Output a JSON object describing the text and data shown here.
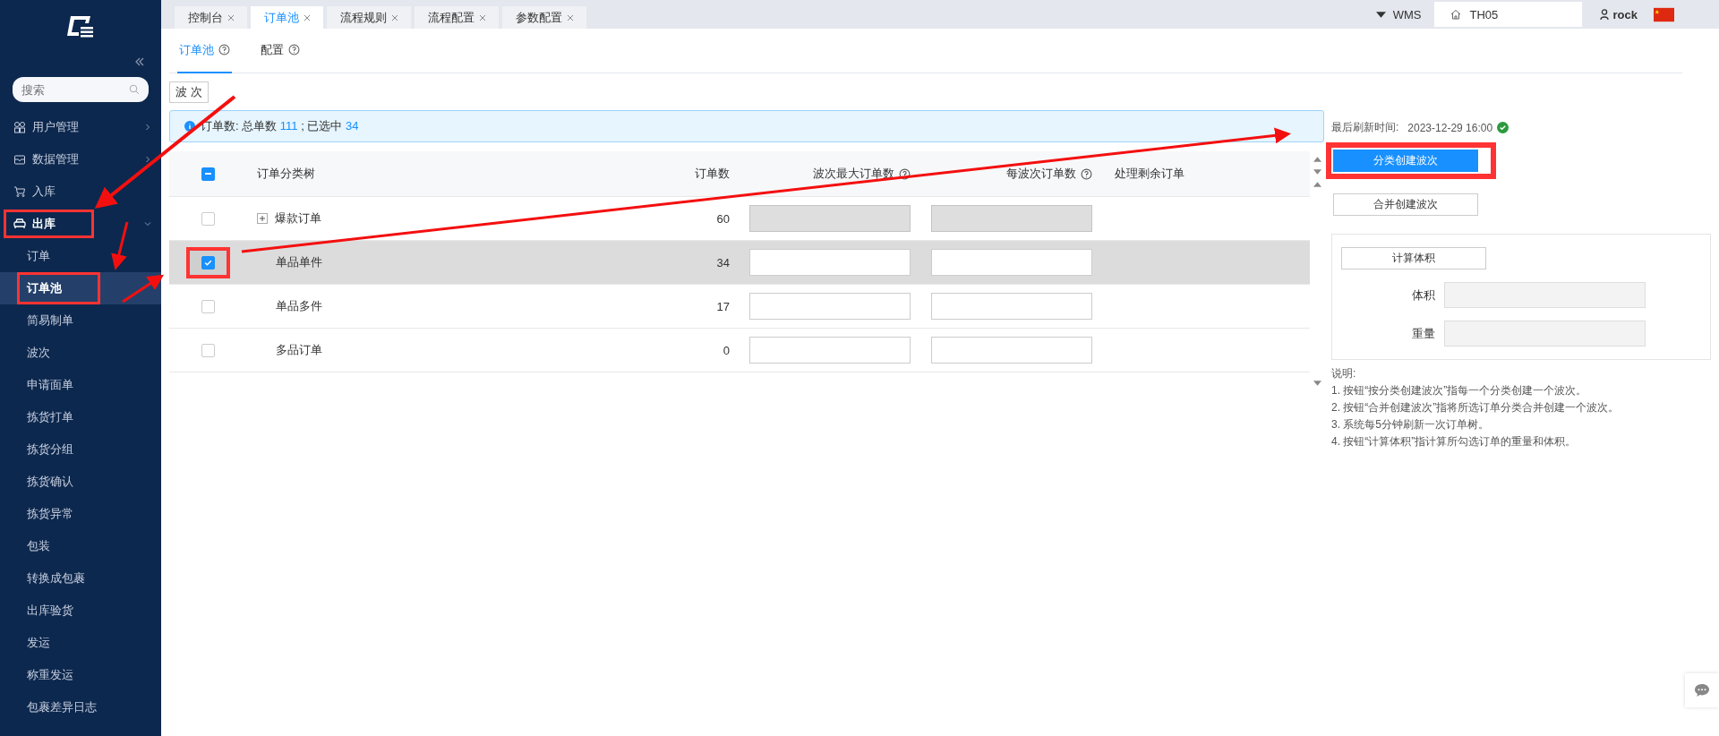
{
  "sidebar": {
    "search": {
      "placeholder": "搜索"
    },
    "items": [
      {
        "label": "用户管理",
        "kind": "users",
        "expanded": false,
        "highlighted": false
      },
      {
        "label": "数据管理",
        "kind": "box",
        "expanded": false,
        "highlighted": false
      },
      {
        "label": "入库",
        "kind": "cart",
        "highlighted": false
      },
      {
        "label": "出库",
        "kind": "truck",
        "expanded": true,
        "highlighted": true,
        "children": [
          {
            "label": "订单",
            "selected": false,
            "highlighted": false
          },
          {
            "label": "订单池",
            "selected": true,
            "highlighted": true
          },
          {
            "label": "简易制单",
            "selected": false,
            "highlighted": false
          },
          {
            "label": "波次",
            "selected": false,
            "highlighted": false
          },
          {
            "label": "申请面单",
            "selected": false,
            "highlighted": false
          },
          {
            "label": "拣货打单",
            "selected": false,
            "highlighted": false
          },
          {
            "label": "拣货分组",
            "selected": false,
            "highlighted": false
          },
          {
            "label": "拣货确认",
            "selected": false,
            "highlighted": false
          },
          {
            "label": "拣货异常",
            "selected": false,
            "highlighted": false
          },
          {
            "label": "包装",
            "selected": false,
            "highlighted": false
          },
          {
            "label": "转换成包裹",
            "selected": false,
            "highlighted": false
          },
          {
            "label": "出库验货",
            "selected": false,
            "highlighted": false
          },
          {
            "label": "发运",
            "selected": false,
            "highlighted": false
          },
          {
            "label": "称重发运",
            "selected": false,
            "highlighted": false
          },
          {
            "label": "包裹差异日志",
            "selected": false,
            "highlighted": false
          }
        ]
      }
    ]
  },
  "tabs": [
    {
      "label": "控制台",
      "selected": false
    },
    {
      "label": "订单池",
      "selected": true
    },
    {
      "label": "流程规则",
      "selected": false
    },
    {
      "label": "流程配置",
      "selected": false
    },
    {
      "label": "参数配置",
      "selected": false
    }
  ],
  "header": {
    "system": "WMS",
    "warehouse": "TH05",
    "user": "rock"
  },
  "subtabs": [
    {
      "label": "订单池",
      "selected": true
    },
    {
      "label": "配置",
      "selected": false
    }
  ],
  "wave_button": "波 次",
  "summary": {
    "label": "订单数: 总单数",
    "total": "111",
    "sep": "; 已选中",
    "selected_count": "34"
  },
  "table": {
    "columns": [
      "订单分类树",
      "订单数",
      "波次最大订单数",
      "每波次订单数",
      "处理剩余订单"
    ],
    "header_checkbox": {
      "indeterminate": true
    },
    "rows": [
      {
        "name": "爆款订单",
        "count": "60",
        "checked": false,
        "expandable": true,
        "disabled": true,
        "highlighted": false
      },
      {
        "name": "单品单件",
        "count": "34",
        "checked": true,
        "expandable": false,
        "disabled": false,
        "highlighted": true
      },
      {
        "name": "单品多件",
        "count": "17",
        "checked": false,
        "expandable": false,
        "disabled": false,
        "highlighted": false
      },
      {
        "name": "多品订单",
        "count": "0",
        "checked": false,
        "expandable": false,
        "disabled": false,
        "highlighted": false
      }
    ]
  },
  "refresh": {
    "label": "最后刷新时间:",
    "time": "2023-12-29 16:00"
  },
  "actions": [
    {
      "label": "分类创建波次",
      "kind": "primary",
      "highlighted": true
    },
    {
      "label": "合并创建波次",
      "kind": "default",
      "highlighted": false
    }
  ],
  "calc": {
    "button": "计算体积",
    "fields": [
      {
        "label": "体积"
      },
      {
        "label": "重量"
      }
    ]
  },
  "notes": {
    "title": "说明:",
    "lines": [
      "1. 按钮“按分类创建波次”指每一个分类创建一个波次。",
      "2. 按钮“合并创建波次”指将所选订单分类合并创建一个波次。",
      "3. 系统每5分钟刷新一次订单树。",
      "4. 按钮“计算体积”指计算所勾选订单的重量和体积。"
    ]
  }
}
